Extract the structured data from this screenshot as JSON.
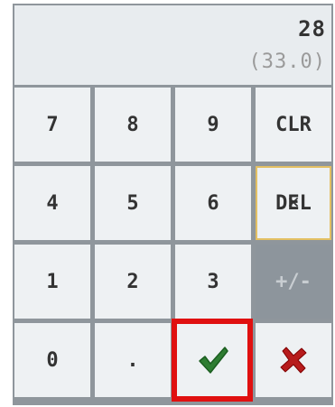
{
  "display": {
    "value": "28",
    "previous": "(33.0)"
  },
  "keys": {
    "k7": "7",
    "k8": "8",
    "k9": "9",
    "clr": "CLR",
    "k4": "4",
    "k5": "5",
    "k6": "6",
    "del": "DEL",
    "k1": "1",
    "k2": "2",
    "k3": "3",
    "sign": "+/-",
    "k0": "0",
    "dot": "."
  },
  "icons": {
    "confirm": "checkmark-icon",
    "cancel": "cross-icon",
    "del_overlay": "backspace-x-icon"
  },
  "colors": {
    "confirm": "#2e7d32",
    "cancel": "#b71c1c",
    "highlight": "#e01010",
    "del_border": "#e3c063"
  }
}
